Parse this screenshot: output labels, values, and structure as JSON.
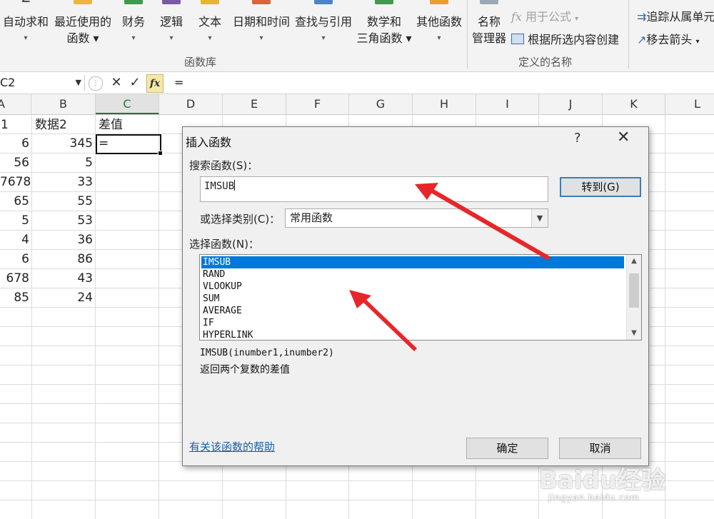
{
  "ribbon": {
    "buttons": [
      {
        "l1": "自动求和",
        "l2": "▾",
        "color": "#444444"
      },
      {
        "l1": "最近使用的",
        "l2": "函数 ▾",
        "color": "#f0b53e"
      },
      {
        "l1": "财务",
        "l2": "▾",
        "color": "#3d9a4b"
      },
      {
        "l1": "逻辑",
        "l2": "▾",
        "color": "#7c5ba6"
      },
      {
        "l1": "文本",
        "l2": "▾",
        "color": "#e8b530"
      },
      {
        "l1": "日期和时间",
        "l2": "▾",
        "color": "#d9653b"
      },
      {
        "l1": "查找与引用",
        "l2": "▾",
        "color": "#4a86c7"
      },
      {
        "l1": "数学和",
        "l2": "三角函数 ▾",
        "color": "#3d9a4b"
      },
      {
        "l1": "其他函数",
        "l2": "▾",
        "color": "#e8a030"
      }
    ],
    "group_function_library": "函数库",
    "name_manager_l1": "名称",
    "name_manager_l2": "管理器",
    "use_in_formula": "用于公式",
    "create_from_selection": "根据所选内容创建",
    "group_defined_names": "定义的名称",
    "trace_precedents": "追踪从属单元",
    "remove_arrows": "移去箭头"
  },
  "formula_bar": {
    "name_box": "C2",
    "cancel": "✕",
    "enter": "✓",
    "fx": "fx",
    "content": "="
  },
  "columns": [
    "A",
    "B",
    "C",
    "D",
    "E",
    "F",
    "G",
    "H",
    "I",
    "J",
    "K",
    "L"
  ],
  "sheet": {
    "header_a": "1",
    "header_b": "数据2",
    "header_c": "差值",
    "c2_value": "=",
    "col_a": [
      "6",
      "56",
      "7678",
      "65",
      "5",
      "4",
      "6",
      "678",
      "85"
    ],
    "col_b": [
      "345",
      "5",
      "33",
      "55",
      "53",
      "36",
      "86",
      "43",
      "24"
    ]
  },
  "dialog": {
    "title": "插入函数",
    "help": "?",
    "close": "✕",
    "search_label": "搜索函数(S)：",
    "search_value": "IMSUB",
    "goto_button": "转到(G)",
    "category_label": "或选择类别(C)：",
    "category_value": "常用函数",
    "select_label": "选择函数(N)：",
    "functions": [
      "IMSUB",
      "RAND",
      "VLOOKUP",
      "SUM",
      "AVERAGE",
      "IF",
      "HYPERLINK"
    ],
    "selected_function": "IMSUB",
    "signature": "IMSUB(inumber1,inumber2)",
    "description": "返回两个复数的差值",
    "help_link": "有关该函数的帮助",
    "ok_button": "确定",
    "cancel_button": "取消"
  },
  "watermark": {
    "brand": "Baidu经验",
    "url": "jingyan.baidu.com"
  },
  "colors": {
    "accent_green": "#217346",
    "selection_blue": "#0078d7",
    "annotation_red": "#e8262a"
  }
}
